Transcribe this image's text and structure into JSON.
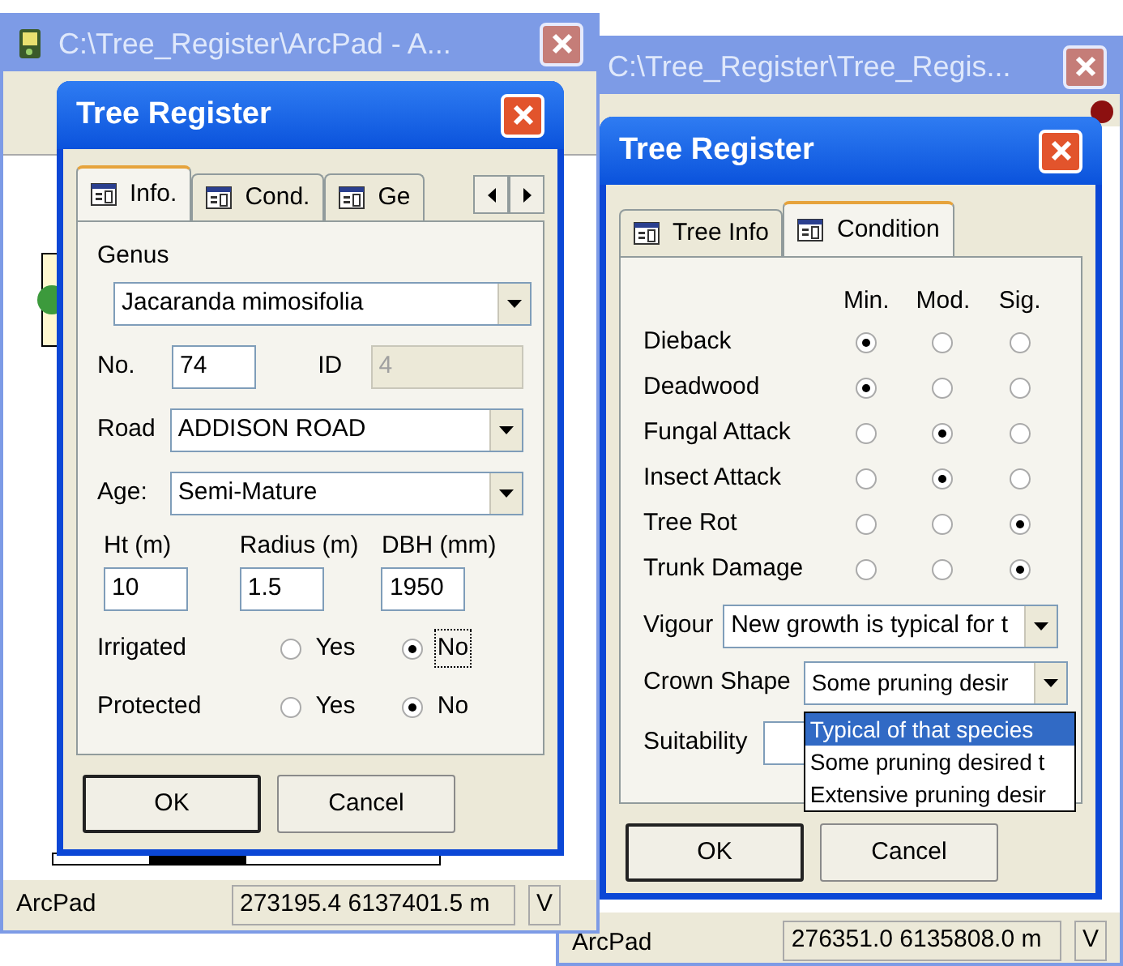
{
  "info_window": {
    "title": "C:\\Tree_Register\\ArcPad - A...",
    "status_bar": {
      "label": "ArcPad",
      "coordinates": "273195.4 6137401.5 m",
      "column_3": "V"
    },
    "dialog": {
      "title": "Tree Register",
      "tabs": [
        {
          "label": "Info.",
          "selected": true
        },
        {
          "label": "Cond.",
          "selected": false
        },
        {
          "label": "Ge",
          "selected": false
        }
      ],
      "genus": {
        "label": "Genus",
        "value": "Jacaranda mimosifolia"
      },
      "number": {
        "label": "No.",
        "value": "74"
      },
      "id": {
        "label": "ID",
        "value": "4",
        "disabled": true
      },
      "road": {
        "label": "Road",
        "value": "ADDISON ROAD"
      },
      "age": {
        "label": "Age:",
        "value": "Semi-Mature"
      },
      "measurements": [
        {
          "label": "Ht (m)",
          "value": "10"
        },
        {
          "label": "Radius (m)",
          "value": "1.5"
        },
        {
          "label": "DBH (mm)",
          "value": "1950"
        }
      ],
      "options": [
        {
          "label": "Irrigated",
          "choices": [
            {
              "label": "Yes",
              "selected": false,
              "focused": false
            },
            {
              "label": "No",
              "selected": true,
              "focused": true
            }
          ]
        },
        {
          "label": "Protected",
          "choices": [
            {
              "label": "Yes",
              "selected": false,
              "focused": false
            },
            {
              "label": "No",
              "selected": true,
              "focused": false
            }
          ]
        }
      ],
      "buttons": [
        {
          "label": "OK",
          "default": true
        },
        {
          "label": "Cancel",
          "default": false
        }
      ]
    }
  },
  "condition_window": {
    "title": "C:\\Tree_Register\\Tree_Regis...",
    "status_bar": {
      "label": "ArcPad",
      "coordinates": "276351.0 6135808.0 m",
      "column_3": "V"
    },
    "dialog": {
      "title": "Tree Register",
      "tabs": [
        {
          "label": "Tree Info",
          "selected": false
        },
        {
          "label": "Condition",
          "selected": true
        }
      ],
      "columns": [
        "Min.",
        "Mod.",
        "Sig."
      ],
      "rows": [
        {
          "label": "Dieback",
          "levels": [
            {
              "selected": true
            },
            {
              "selected": false
            },
            {
              "selected": false
            }
          ]
        },
        {
          "label": "Deadwood",
          "levels": [
            {
              "selected": true
            },
            {
              "selected": false
            },
            {
              "selected": false
            }
          ]
        },
        {
          "label": "Fungal Attack",
          "levels": [
            {
              "selected": false
            },
            {
              "selected": true
            },
            {
              "selected": false
            }
          ]
        },
        {
          "label": "Insect Attack",
          "levels": [
            {
              "selected": false
            },
            {
              "selected": true
            },
            {
              "selected": false
            }
          ]
        },
        {
          "label": "Tree Rot",
          "levels": [
            {
              "selected": false
            },
            {
              "selected": false
            },
            {
              "selected": true
            }
          ]
        },
        {
          "label": "Trunk Damage",
          "levels": [
            {
              "selected": false
            },
            {
              "selected": false
            },
            {
              "selected": true
            }
          ]
        }
      ],
      "vigour": {
        "label": "Vigour",
        "value": "New growth is typical for t"
      },
      "crown_shape": {
        "label": "Crown Shape",
        "value": "Some pruning desir",
        "expanded": true,
        "options": [
          {
            "label": "Typical of that species",
            "selected": true
          },
          {
            "label": "Some pruning desired t",
            "selected": false
          },
          {
            "label": "Extensive pruning desir",
            "selected": false
          }
        ]
      },
      "suitability": {
        "label": "Suitability"
      },
      "buttons": [
        {
          "label": "OK",
          "default": true
        },
        {
          "label": "Cancel",
          "default": false
        }
      ]
    }
  }
}
